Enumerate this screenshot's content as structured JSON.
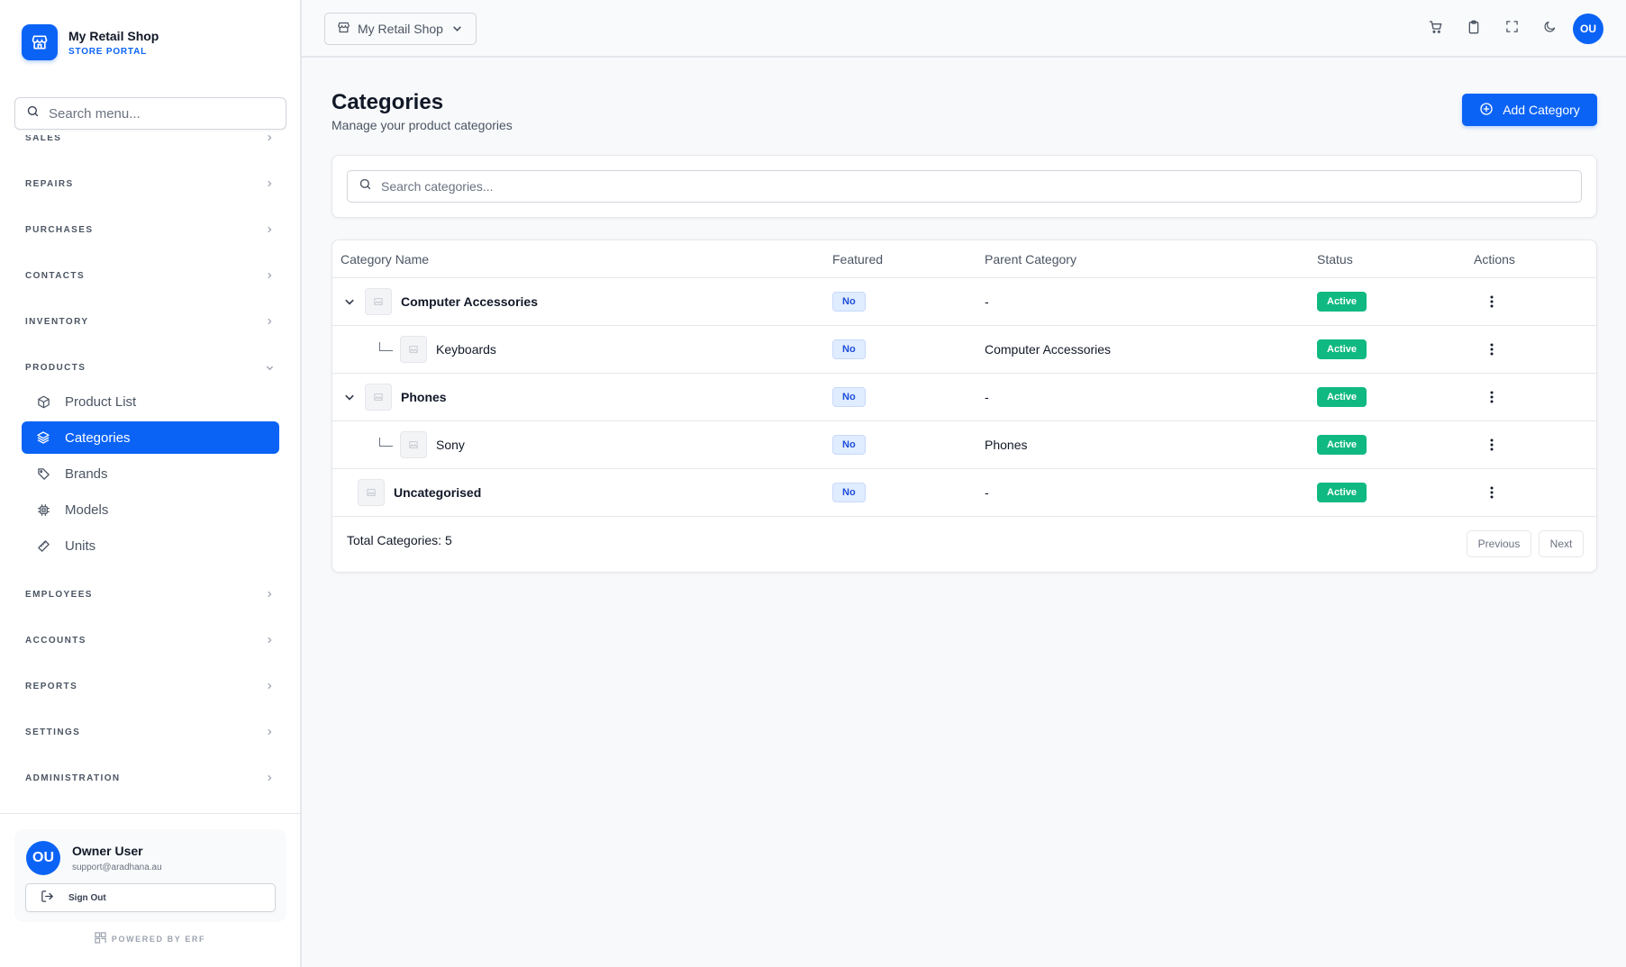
{
  "brand": {
    "name": "My Retail Shop",
    "subtitle": "STORE PORTAL"
  },
  "menu_search": {
    "placeholder": "Search menu..."
  },
  "nav": {
    "sections": {
      "sales": "SALES",
      "repairs": "REPAIRS",
      "purchases": "PURCHASES",
      "contacts": "CONTACTS",
      "inventory": "INVENTORY",
      "products": "PRODUCTS",
      "employees": "EMPLOYEES",
      "accounts": "ACCOUNTS",
      "reports": "REPORTS",
      "settings": "SETTINGS",
      "administration": "ADMINISTRATION"
    },
    "products_items": [
      {
        "label": "Product List",
        "icon": "box-icon"
      },
      {
        "label": "Categories",
        "icon": "layers-icon",
        "active": true
      },
      {
        "label": "Brands",
        "icon": "tag-icon"
      },
      {
        "label": "Models",
        "icon": "chip-icon"
      },
      {
        "label": "Units",
        "icon": "ruler-icon"
      }
    ]
  },
  "user": {
    "initials": "OU",
    "name": "Owner User",
    "email": "support@aradhana.au",
    "signout_label": "Sign Out"
  },
  "powered_by": "POWERED BY ERF",
  "topbar": {
    "shop_label": "My Retail Shop",
    "avatar_initials": "OU"
  },
  "page": {
    "title": "Categories",
    "subtitle": "Manage your product categories",
    "add_label": "Add Category"
  },
  "table_search": {
    "placeholder": "Search categories..."
  },
  "table": {
    "headers": {
      "name": "Category Name",
      "featured": "Featured",
      "parent": "Parent Category",
      "status": "Status",
      "actions": "Actions"
    },
    "rows": [
      {
        "name": "Computer Accessories",
        "featured": "No",
        "parent": "-",
        "status": "Active"
      },
      {
        "name": "Keyboards",
        "featured": "No",
        "parent": "Computer Accessories",
        "status": "Active"
      },
      {
        "name": "Phones",
        "featured": "No",
        "parent": "-",
        "status": "Active"
      },
      {
        "name": "Sony",
        "featured": "No",
        "parent": "Phones",
        "status": "Active"
      },
      {
        "name": "Uncategorised",
        "featured": "No",
        "parent": "-",
        "status": "Active"
      }
    ],
    "total_label": "Total Categories: 5",
    "prev_label": "Previous",
    "next_label": "Next"
  },
  "colors": {
    "accent": "#0b63f6",
    "active_badge": "#10b981"
  }
}
